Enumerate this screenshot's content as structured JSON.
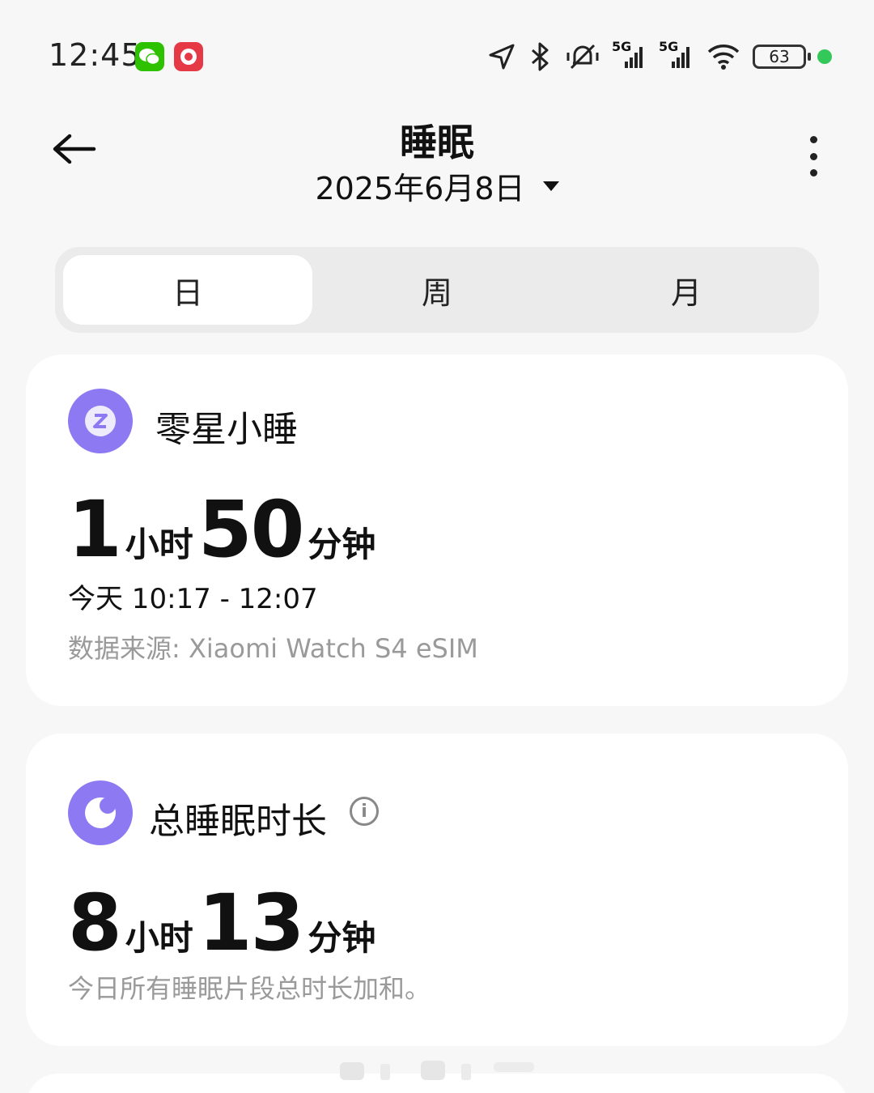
{
  "status_bar": {
    "time": "12:45",
    "battery": "63",
    "network_1": "5G",
    "network_2": "5G",
    "icons": [
      "wechat-icon",
      "app-promo-icon",
      "location-icon",
      "bluetooth-icon",
      "mute-icon",
      "signal-icon",
      "signal-icon",
      "wifi-icon",
      "battery-icon"
    ],
    "dot_color": "#34c759"
  },
  "header": {
    "title": "睡眠",
    "date": "2025年6月8日"
  },
  "tabs": [
    {
      "label": "日",
      "active": true
    },
    {
      "label": "周",
      "active": false
    },
    {
      "label": "月",
      "active": false
    }
  ],
  "nap_card": {
    "title": "零星小睡",
    "hours": "1",
    "hours_unit": "小时",
    "minutes": "50",
    "minutes_unit": "分钟",
    "time_range": "今天 10:17 - 12:07",
    "source": "数据来源: Xiaomi Watch S4 eSIM",
    "icon_color": "#8d79f2"
  },
  "total_card": {
    "title": "总睡眠时长",
    "hours": "8",
    "hours_unit": "小时",
    "minutes": "13",
    "minutes_unit": "分钟",
    "note": "今日所有睡眠片段总时长加和。",
    "icon_color": "#8d79f2"
  }
}
